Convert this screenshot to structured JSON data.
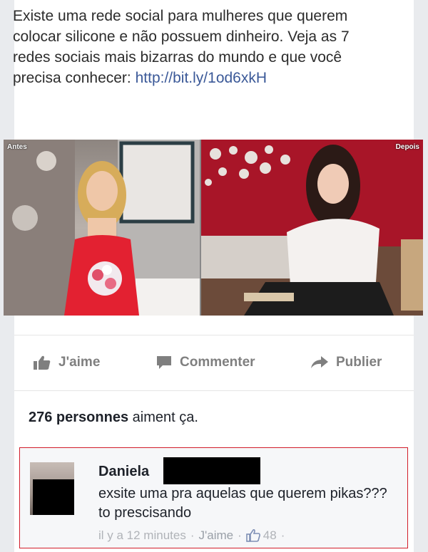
{
  "post": {
    "text": "Existe uma rede social para mulheres que querem colocar silicone e não possuem dinheiro. Veja as 7 redes sociais mais bizarras do mundo e que você precisa conhecer: ",
    "link": "http://bit.ly/1od6xkH"
  },
  "photo": {
    "label_left": "Antes",
    "label_right": "Depois"
  },
  "actions": {
    "like": "J'aime",
    "comment": "Commenter",
    "share": "Publier"
  },
  "likes_summary": {
    "count_text": "276 personnes",
    "suffix": " aiment ça."
  },
  "comment": {
    "author": "Daniela",
    "text": "exsite uma pra aquelas que querem pikas??? to prescisando",
    "time": "il y a 12 minutes",
    "like_label": "J'aime",
    "like_count": "48",
    "separator": "·"
  },
  "colors": {
    "link": "#3b5998",
    "highlight_border": "#d21d2a",
    "action_gray": "#7f7f7f"
  },
  "icons": {
    "like": "thumbs-up-icon",
    "comment": "speech-bubble-icon",
    "share": "share-arrow-icon"
  }
}
